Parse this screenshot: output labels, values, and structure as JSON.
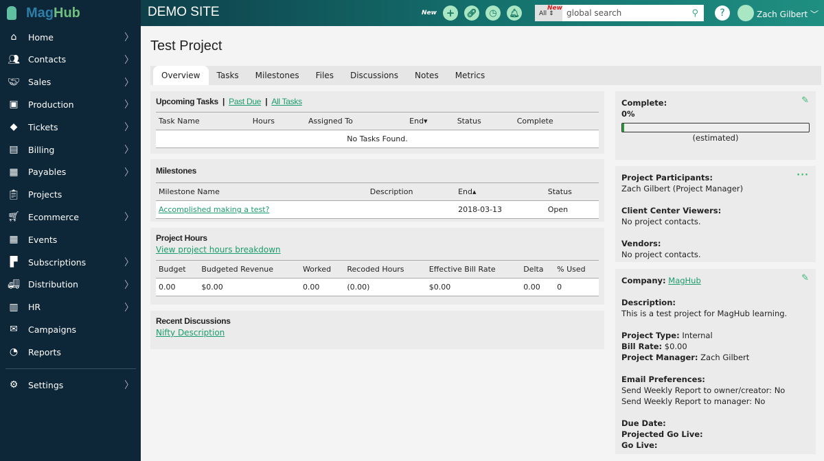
{
  "brand": {
    "part1": "Mag",
    "part2": "Hub"
  },
  "sidebar": {
    "items": [
      {
        "label": "Home",
        "icon": "home-icon",
        "chev": true
      },
      {
        "label": "Contacts",
        "icon": "contacts-icon",
        "chev": true
      },
      {
        "label": "Sales",
        "icon": "handshake-icon",
        "chev": true
      },
      {
        "label": "Production",
        "icon": "image-icon",
        "chev": true
      },
      {
        "label": "Tickets",
        "icon": "ticket-icon",
        "chev": true
      },
      {
        "label": "Billing",
        "icon": "billing-icon",
        "chev": true
      },
      {
        "label": "Payables",
        "icon": "payables-icon",
        "chev": true
      },
      {
        "label": "Projects",
        "icon": "clipboard-icon",
        "chev": false
      },
      {
        "label": "Ecommerce",
        "icon": "cart-icon",
        "chev": true
      },
      {
        "label": "Events",
        "icon": "calendar-icon",
        "chev": false
      },
      {
        "label": "Subscriptions",
        "icon": "subscriptions-icon",
        "chev": true
      },
      {
        "label": "Distribution",
        "icon": "truck-icon",
        "chev": true
      },
      {
        "label": "HR",
        "icon": "hr-icon",
        "chev": true
      },
      {
        "label": "Campaigns",
        "icon": "envelope-icon",
        "chev": false
      },
      {
        "label": "Reports",
        "icon": "reports-icon",
        "chev": false
      }
    ],
    "settings": "Settings"
  },
  "header": {
    "site": "DEMO SITE",
    "new_label": "New",
    "search_scope": "All",
    "search_new": "New",
    "search_placeholder": "global search",
    "help": "?",
    "user": "Zach Gilbert ﹀"
  },
  "page": {
    "title": "Test Project",
    "tabs": [
      "Overview",
      "Tasks",
      "Milestones",
      "Files",
      "Discussions",
      "Notes",
      "Metrics"
    ]
  },
  "tasks": {
    "title": "Upcoming Tasks",
    "sep": "|",
    "past_due": "Past Due",
    "all_tasks": "All Tasks",
    "columns": [
      "Task Name",
      "Hours",
      "Assigned To",
      "End▾",
      "Status",
      "Complete"
    ],
    "empty": "No Tasks Found."
  },
  "milestones": {
    "title": "Milestones",
    "columns": [
      "Milestone Name",
      "Description",
      "End▴",
      "Status"
    ],
    "rows": [
      [
        "Accomplished making a test?",
        "",
        "2018-03-13",
        "Open"
      ]
    ]
  },
  "hours": {
    "title": "Project Hours",
    "link": "View project hours breakdown",
    "columns": [
      "Budget",
      "Budgeted Revenue",
      "Worked",
      "Recoded Hours",
      "Effective Bill Rate",
      "Delta",
      "% Used"
    ],
    "rows": [
      [
        "0.00",
        "$0.00",
        "0.00",
        "(0.00)",
        "$0.00",
        "0.00",
        "0"
      ]
    ]
  },
  "discussions": {
    "title": "Recent Discussions",
    "items": [
      "Nifty Description"
    ]
  },
  "complete": {
    "label": "Complete:",
    "value": "0%",
    "percent": 0.01,
    "note": "(estimated)"
  },
  "participants": {
    "pp_label": "Project Participants:",
    "pp_value": "Zach Gilbert (Project Manager)",
    "cc_label": "Client Center Viewers:",
    "cc_value": "No project contacts.",
    "v_label": "Vendors:",
    "v_value": "No project contacts."
  },
  "details": {
    "company_label": "Company:",
    "company": "MagHub",
    "desc_label": "Description:",
    "desc": "This is a test project for MagHub learning.",
    "type_label": "Project Type:",
    "type": "Internal",
    "rate_label": "Bill Rate:",
    "rate": "$0.00",
    "pm_label": "Project Manager:",
    "pm": "Zach Gilbert",
    "email_label": "Email Preferences:",
    "email1": "Send Weekly Report to owner/creator: No",
    "email2": "Send Weekly Report to manager: No",
    "due_label": "Due Date:",
    "golive_proj_label": "Projected Go Live:",
    "golive_label": "Go Live:"
  }
}
